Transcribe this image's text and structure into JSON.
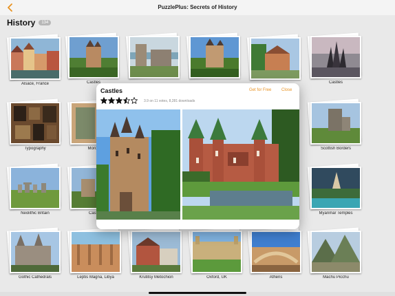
{
  "app": {
    "title": "PuzzlePlus: Secrets of History"
  },
  "section": {
    "title": "History",
    "count": "134"
  },
  "tiles": [
    {
      "label": "Alsace, France"
    },
    {
      "label": "Castles"
    },
    {
      "label": ""
    },
    {
      "label": ""
    },
    {
      "label": ""
    },
    {
      "label": "Castles"
    },
    {
      "label": "Typography"
    },
    {
      "label": "Morocco"
    },
    {
      "label": "Scottish Borders"
    },
    {
      "label": "Neolithic Britain"
    },
    {
      "label": "Castles"
    },
    {
      "label": "Myanmar Temples"
    },
    {
      "label": "Gothic Cathedrals"
    },
    {
      "label": "Leptis Magna, Libya"
    },
    {
      "label": "Krutitsy Metochion"
    },
    {
      "label": "Oxford, UK"
    },
    {
      "label": "Athens"
    },
    {
      "label": "Machu Picchu"
    }
  ],
  "popup": {
    "title": "Castles",
    "get_label": "Get for Free",
    "close_label": "Close",
    "rating_value": 3.5,
    "rating_text": "3.9 on 11 votes, 8,281 downloads"
  },
  "colors": {
    "accent": "#e8911f",
    "background": "#e9e9e9",
    "badge": "#b7b7b7"
  },
  "icons": {
    "back": "chevron-left-icon",
    "star": "star-icon"
  }
}
